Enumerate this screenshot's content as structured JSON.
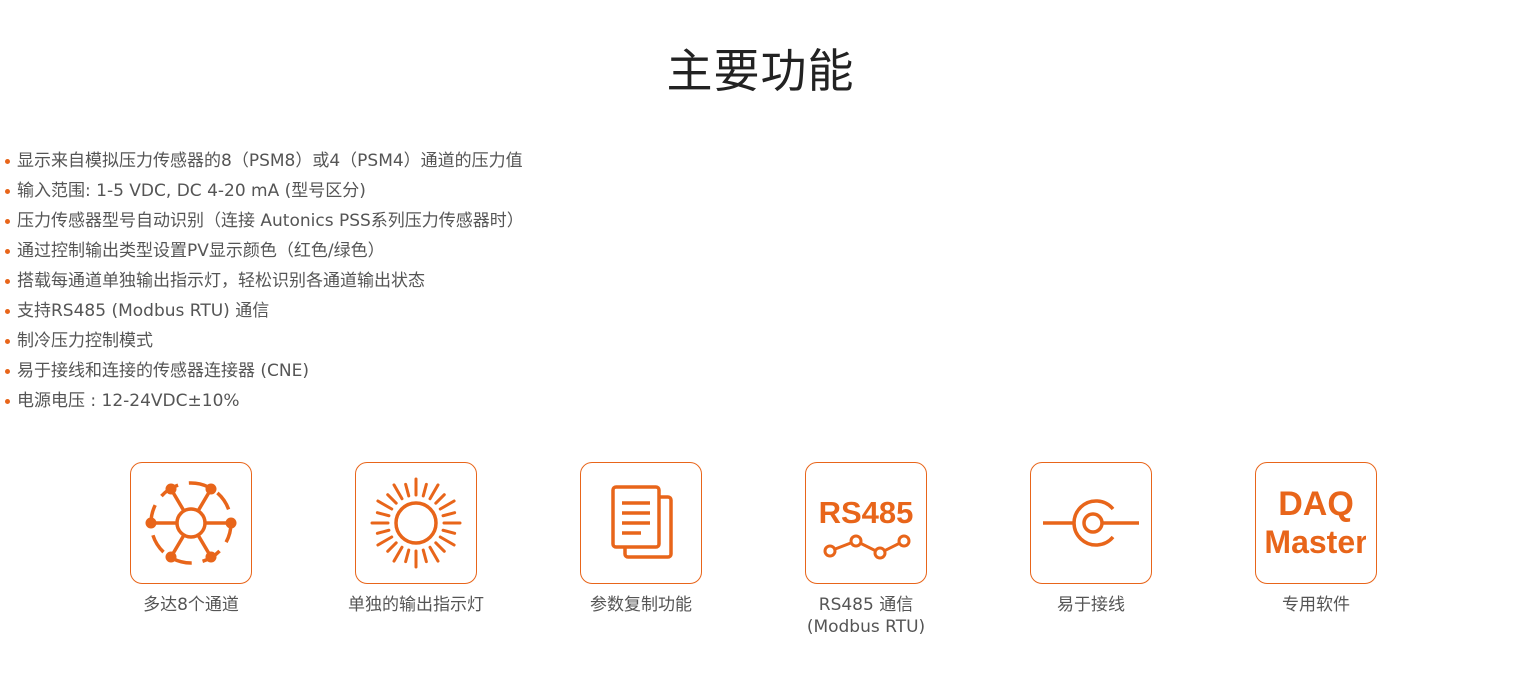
{
  "page": {
    "title": "主要功能"
  },
  "colors": {
    "accent": "#e8651a",
    "text": "#555555",
    "title": "#222222"
  },
  "features": [
    "显示来自模拟压力传感器的8（PSM8）或4（PSM4）通道的压力值",
    "输入范围: 1-5 VDC, DC 4-20 mA (型号区分)",
    "压力传感器型号自动识别（连接 Autonics PSS系列压力传感器时）",
    "通过控制输出类型设置PV显示颜色（红色/绿色）",
    "搭载每通道单独输出指示灯，轻松识别各通道输出状态",
    "支持RS485 (Modbus RTU) 通信",
    "制冷压力控制模式",
    "易于接线和连接的传感器连接器 (CNE)",
    "电源电压 : 12-24VDC±10%"
  ],
  "icons": [
    {
      "icon": "channels-network-icon",
      "label": "多达8个通道",
      "label2": ""
    },
    {
      "icon": "sun-indicator-icon",
      "label": "单独的输出指示灯",
      "label2": ""
    },
    {
      "icon": "copy-documents-icon",
      "label": "参数复制功能",
      "label2": ""
    },
    {
      "icon": "rs485-icon",
      "label": "RS485 通信",
      "label2": "(Modbus RTU)",
      "glyph_text": "RS485"
    },
    {
      "icon": "connector-wiring-icon",
      "label": "易于接线",
      "label2": ""
    },
    {
      "icon": "daq-master-icon",
      "label": "专用软件",
      "label2": "",
      "glyph_line1": "DAQ",
      "glyph_line2": "Master"
    }
  ]
}
